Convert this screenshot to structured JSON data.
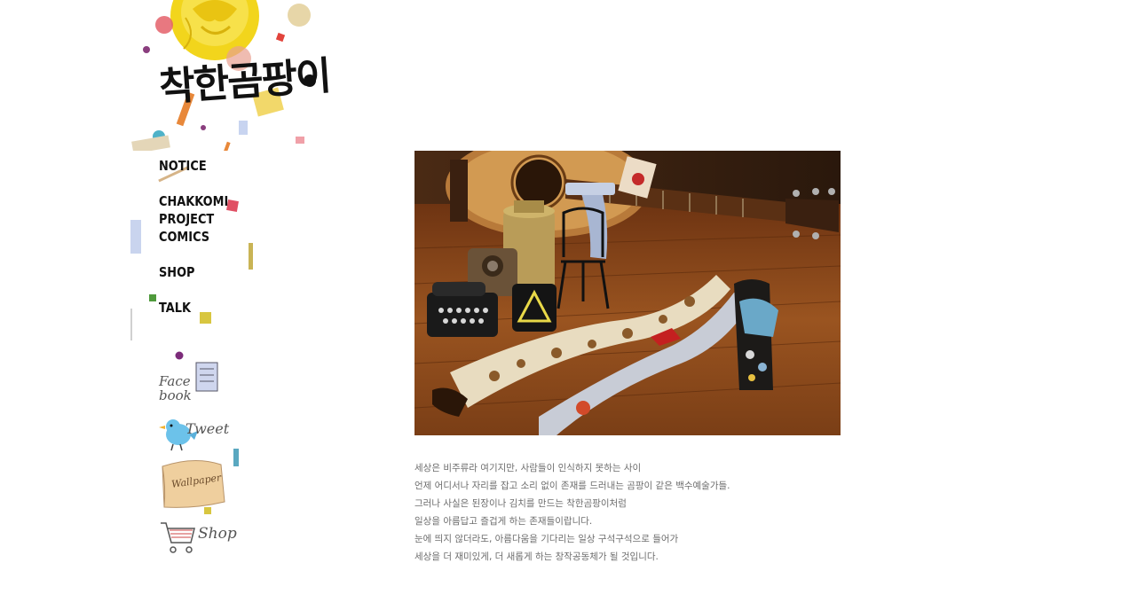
{
  "site": {
    "logo_text": "착한곰팡이"
  },
  "nav": {
    "items": [
      {
        "label": "NOTICE"
      },
      {
        "label_lines": [
          "CHAKKOMI",
          "PROJECT",
          "COMICS"
        ]
      },
      {
        "label": "SHOP"
      },
      {
        "label": "TALK"
      }
    ]
  },
  "social": {
    "facebook_label": "Face book",
    "tweet_label": "Tweet",
    "wallpaper_label": "Wallpaper",
    "shop_label": "Shop"
  },
  "main": {
    "photo_icon": "guitar-straps-photo",
    "description_lines": [
      "세상은 비주류라 여기지만, 사람들이 인식하지 못하는 사이",
      "언제 어디서나 자리를 잡고 소리 없이 존재를 드러내는 곰팡이 같은 백수예술가들.",
      "그러나 사실은 된장이나 김치를 만드는 착한곰팡이처럼",
      "일상을 아름답고 즐겁게 하는 존재들이랍니다.",
      "눈에 띄지 않더라도, 아름다움을 기다리는 일상 구석구석으로 들어가",
      "세상을 더 재미있게, 더 새롭게 하는 창작공동체가 될 것입니다."
    ]
  },
  "colors": {
    "accent_yellow": "#f2d51c",
    "text_gray": "#6d6d6d",
    "nav_text": "#111111",
    "wood": "#8a4a1c"
  }
}
